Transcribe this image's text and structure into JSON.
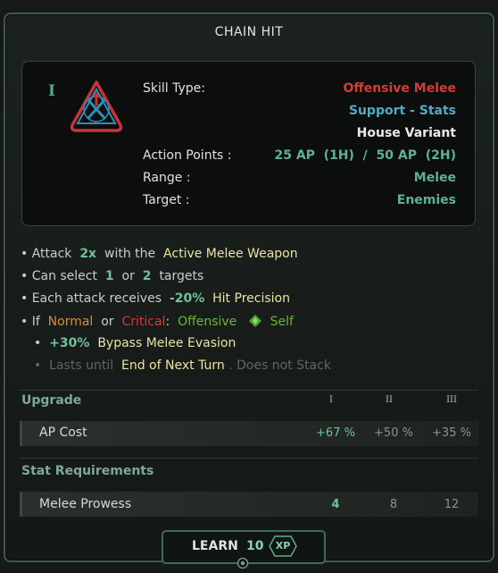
{
  "window": {
    "title": "CHAIN HIT"
  },
  "header": {
    "rank": "I",
    "icon": "crossed-swords-triangle-icon",
    "skill_type_label": "Skill Type:",
    "skill_type": "Offensive Melee",
    "sub_type": "Support - Stats",
    "variant": "House Variant",
    "action_points_label": "Action Points :",
    "action_points": "25 AP  (1H)  /  50 AP  (2H)",
    "range_label": "Range :",
    "range": "Melee",
    "target_label": "Target :",
    "target": "Enemies"
  },
  "description": {
    "line1": {
      "a": "• Attack",
      "b": "2x",
      "c": "with the",
      "d": "Active Melee Weapon"
    },
    "line2": {
      "a": "• Can select",
      "b": "1",
      "c": "or",
      "d": "2",
      "e": "targets"
    },
    "line3": {
      "a": "• Each attack receives",
      "b": "-20%",
      "c": "Hit Precision"
    },
    "line4": {
      "a": "• If",
      "b": "Normal",
      "c": "or",
      "d": "Critical",
      "e": ":",
      "f": "Offensive",
      "g": "Self"
    },
    "line5": {
      "a": "•",
      "b": "+30%",
      "c": "Bypass Melee Evasion"
    },
    "line6": {
      "a": "•",
      "b": "Lasts until",
      "c": "End of Next Turn",
      "d": ". Does not Stack"
    }
  },
  "upgrade": {
    "heading": "Upgrade",
    "columns": [
      "I",
      "II",
      "III"
    ],
    "row_label": "AP Cost",
    "values": [
      "+67 %",
      "+50 %",
      "+35 %"
    ]
  },
  "requirements": {
    "heading": "Stat Requirements",
    "row_label": "Melee Prowess",
    "values": [
      "4",
      "8",
      "12"
    ]
  },
  "learn": {
    "label": "LEARN",
    "cost": "10",
    "currency": "XP"
  }
}
